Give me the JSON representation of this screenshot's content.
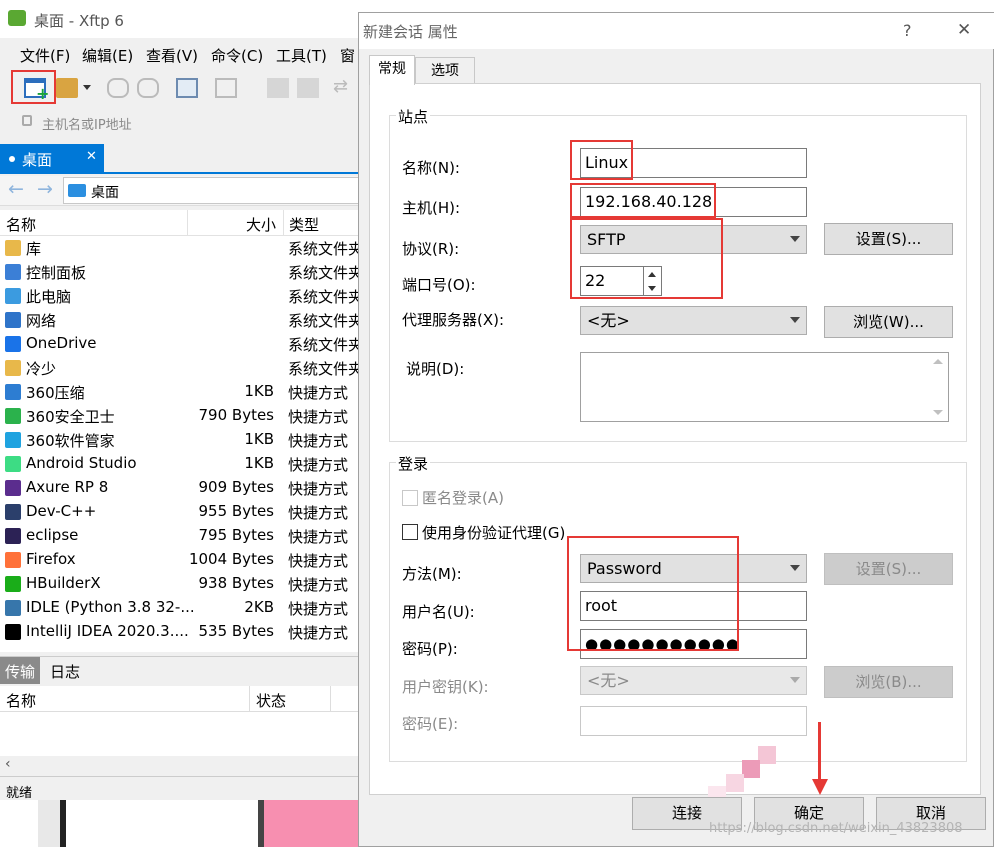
{
  "xftp": {
    "title": "桌面 - Xftp 6",
    "menu": [
      "文件(F)",
      "编辑(E)",
      "查看(V)",
      "命令(C)",
      "工具(T)",
      "窗"
    ],
    "address_placeholder": "主机名或IP地址",
    "tab_label": "桌面",
    "path": "桌面",
    "columns": {
      "name": "名称",
      "size": "大小",
      "type": "类型"
    },
    "files": [
      {
        "name": "库",
        "size": "",
        "type": "系统文件夹",
        "color": "#e8b84a"
      },
      {
        "name": "控制面板",
        "size": "",
        "type": "系统文件夹",
        "color": "#3b7fd6"
      },
      {
        "name": "此电脑",
        "size": "",
        "type": "系统文件夹",
        "color": "#3b9be0"
      },
      {
        "name": "网络",
        "size": "",
        "type": "系统文件夹",
        "color": "#2f74c9"
      },
      {
        "name": "OneDrive",
        "size": "",
        "type": "系统文件夹",
        "color": "#1a73e8"
      },
      {
        "name": "冷少",
        "size": "",
        "type": "系统文件夹",
        "color": "#e8b84a"
      },
      {
        "name": "360压缩",
        "size": "1KB",
        "type": "快捷方式",
        "color": "#2d7dd2"
      },
      {
        "name": "360安全卫士",
        "size": "790 Bytes",
        "type": "快捷方式",
        "color": "#2bb24c"
      },
      {
        "name": "360软件管家",
        "size": "1KB",
        "type": "快捷方式",
        "color": "#1fa3e0"
      },
      {
        "name": "Android Studio",
        "size": "1KB",
        "type": "快捷方式",
        "color": "#3ddc84"
      },
      {
        "name": "Axure RP 8",
        "size": "909 Bytes",
        "type": "快捷方式",
        "color": "#5b2d8e"
      },
      {
        "name": "Dev-C++",
        "size": "955 Bytes",
        "type": "快捷方式",
        "color": "#2b3f6b"
      },
      {
        "name": "eclipse",
        "size": "795 Bytes",
        "type": "快捷方式",
        "color": "#2c2255"
      },
      {
        "name": "Firefox",
        "size": "1004 Bytes",
        "type": "快捷方式",
        "color": "#ff7139"
      },
      {
        "name": "HBuilderX",
        "size": "938 Bytes",
        "type": "快捷方式",
        "color": "#1aad19"
      },
      {
        "name": "IDLE (Python 3.8 32-...",
        "size": "2KB",
        "type": "快捷方式",
        "color": "#3776ab"
      },
      {
        "name": "IntelliJ IDEA 2020.3....",
        "size": "535 Bytes",
        "type": "快捷方式",
        "color": "#000000"
      }
    ],
    "transfer_tabs": [
      "传输",
      "日志"
    ],
    "transfer_columns": {
      "name": "名称",
      "status": "状态"
    },
    "status": "就绪"
  },
  "dialog": {
    "title": "新建会话 属性",
    "help": "?",
    "close": "✕",
    "tabs": [
      "常规",
      "选项"
    ],
    "site": {
      "group_label": "站点",
      "name_label": "名称(N):",
      "name_value": "Linux",
      "host_label": "主机(H):",
      "host_value": "192.168.40.128",
      "protocol_label": "协议(R):",
      "protocol_value": "SFTP",
      "settings_button": "设置(S)...",
      "port_label": "端口号(O):",
      "port_value": "22",
      "proxy_label": "代理服务器(X):",
      "proxy_value": "<无>",
      "browse_button": "浏览(W)...",
      "desc_label": "说明(D):"
    },
    "login": {
      "group_label": "登录",
      "anonymous_label": "匿名登录(A)",
      "agent_label": "使用身份验证代理(G)",
      "method_label": "方法(M):",
      "method_value": "Password",
      "method_settings_button": "设置(S)...",
      "username_label": "用户名(U):",
      "username_value": "root",
      "password_label": "密码(P):",
      "password_value": "●●●●●●●●●●●",
      "userkey_label": "用户密钥(K):",
      "userkey_value": "<无>",
      "userkey_browse_button": "浏览(B)...",
      "passphrase_label": "密码(E):"
    },
    "buttons": {
      "connect": "连接",
      "ok": "确定",
      "cancel": "取消"
    },
    "watermark": "https://blog.csdn.net/weixin_43823808"
  },
  "colors": {
    "highlight": "#e53935",
    "accent": "#0078d7"
  }
}
